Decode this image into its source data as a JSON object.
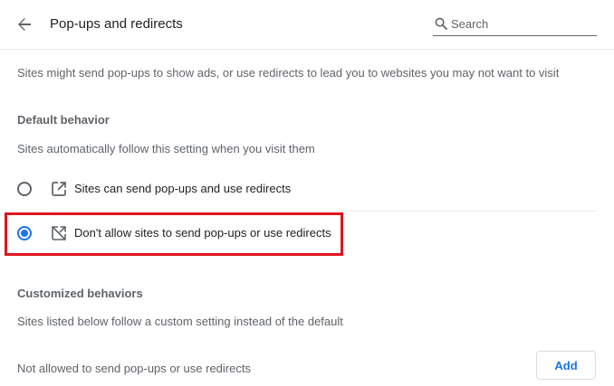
{
  "header": {
    "title": "Pop-ups and redirects",
    "search_placeholder": "Search"
  },
  "description": "Sites might send pop-ups to show ads, or use redirects to lead you to websites you may not want to visit",
  "default_behavior": {
    "title": "Default behavior",
    "subtitle": "Sites automatically follow this setting when you visit them",
    "options": [
      {
        "label": "Sites can send pop-ups and use redirects",
        "icon": "open-in-new-icon",
        "selected": false
      },
      {
        "label": "Don't allow sites to send pop-ups or use redirects",
        "icon": "popups-blocked-icon",
        "selected": true
      }
    ]
  },
  "customized_behaviors": {
    "title": "Customized behaviors",
    "subtitle": "Sites listed below follow a custom setting instead of the default",
    "not_allowed_label": "Not allowed to send pop-ups or use redirects",
    "add_label": "Add"
  },
  "colors": {
    "accent": "#1a73e8",
    "highlight": "#e0141e",
    "secondary_text": "#5f6368"
  }
}
